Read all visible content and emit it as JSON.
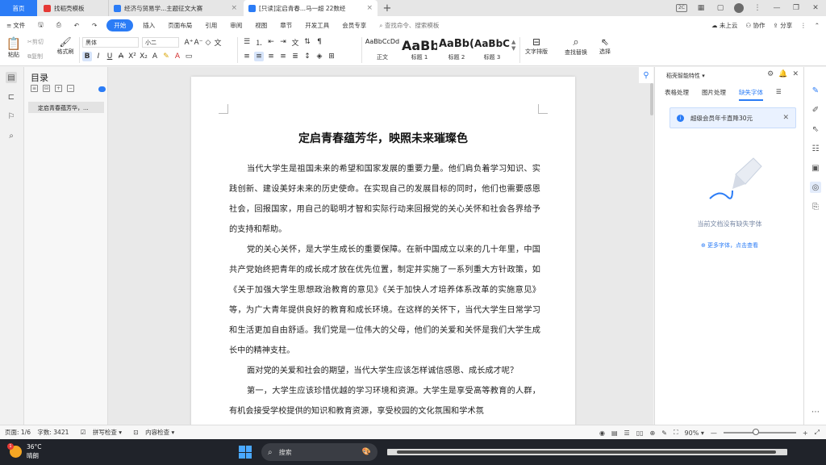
{
  "tabs": {
    "home": "首页",
    "t1": "找稻壳模板",
    "t2": "经济与贸易学...主题征文大赛",
    "t3": "[只读]定启青春...马一超 22数经",
    "add": "+"
  },
  "menubar": {
    "file": "文件",
    "items": [
      "开始",
      "插入",
      "页面布局",
      "引用",
      "审阅",
      "视图",
      "章节",
      "开发工具",
      "会员专享"
    ],
    "search_placeholder": "查找命令、搜索模板",
    "cloud": "未上云",
    "collab": "协作",
    "share": "分享"
  },
  "ribbon": {
    "paste": "粘贴",
    "cut": "剪切",
    "copy": "复制",
    "format_painter": "格式刷",
    "font_name": "黑体",
    "font_size": "小二",
    "styles": [
      {
        "sample": "AaBbCcDd",
        "label": "正文"
      },
      {
        "sample": "AaBb",
        "label": "标题 1"
      },
      {
        "sample": "AaBb(",
        "label": "标题 2"
      },
      {
        "sample": "AaBbC",
        "label": "标题 3"
      }
    ],
    "text_layout": "文字排版",
    "find_replace": "查找替换",
    "select": "选择"
  },
  "toc": {
    "title": "目录",
    "item": "定启青春蕴芳华，..."
  },
  "document": {
    "title": "定启青春蕴芳华，映照未来璀璨色",
    "paragraphs": [
      "当代大学生是祖国未来的希望和国家发展的重要力量。他们肩负着学习知识、实践创新、建设美好未来的历史使命。在实现自己的发展目标的同时，他们也需要感恩社会，回报国家，用自己的聪明才智和实际行动来回报党的关心关怀和社会各界给予的支持和帮助。",
      "党的关心关怀，是大学生成长的重要保障。在新中国成立以来的几十年里，中国共产党始终把青年的成长成才放在优先位置，制定并实施了一系列重大方针政策，如《关于加强大学生思想政治教育的意见》《关于加快人才培养体系改革的实施意见》等，为广大青年提供良好的教育和成长环境。在这样的关怀下，当代大学生日常学习和生活更加自由舒适。我们党是一位伟大的父母，他们的关爱和关怀是我们大学生成长中的精神支柱。",
      "面对党的关爱和社会的期望，当代大学生应该怎样诚信感恩、成长成才呢？",
      "第一，大学生应该珍惜优越的学习环境和资源。大学生是享受高等教育的人群，有机会接受学校提供的知识和教育资源，享受校园的文化氛围和学术氛"
    ]
  },
  "right_panel": {
    "header": "稻壳智能特性",
    "tabs": [
      "表格处理",
      "图片处理",
      "缺失字体"
    ],
    "banner": "超级会员年卡直降30元",
    "message": "当前文档没有缺失字体",
    "link": "更多字体，点击查看"
  },
  "statusbar": {
    "page": "页面: 1/6",
    "words": "字数: 3421",
    "spell": "拼写检查",
    "content": "内容检查",
    "zoom": "90%",
    "zoom_fraction": 0.45
  },
  "taskbar": {
    "temp": "36°C",
    "weather": "晴朗",
    "search": "搜索",
    "badge": "1"
  },
  "colors": {
    "accent": "#2b7cf6",
    "taskbar": "#20232a"
  }
}
